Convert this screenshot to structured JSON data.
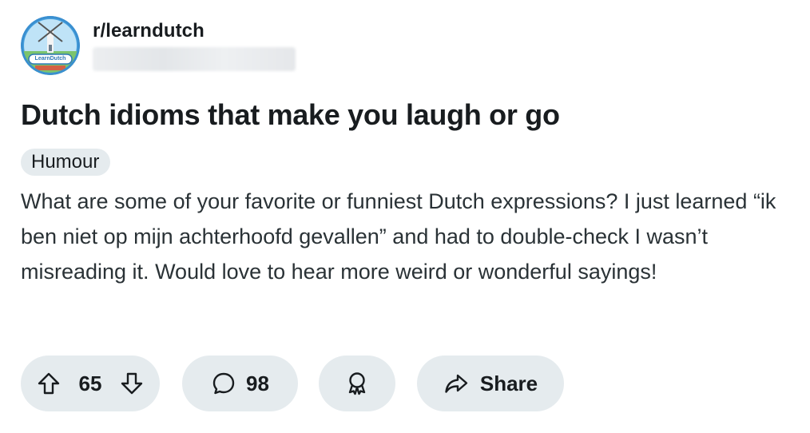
{
  "post": {
    "subreddit": "r/learndutch",
    "avatar_logo_text": "LearnDutch",
    "title": "Dutch idioms that make you laugh or go",
    "flair": "Humour",
    "body": "What are some of your favorite or funniest Dutch expressions? I just learned “ik ben niet op mijn achterhoofd gevallen” and had to double-check I wasn’t misreading it. Would love to hear more weird or wonderful sayings!"
  },
  "actions": {
    "upvote_icon": "arrow-up-icon",
    "vote_count": "65",
    "downvote_icon": "arrow-down-icon",
    "comment_icon": "speech-bubble-icon",
    "comment_count": "98",
    "award_icon": "award-icon",
    "share_icon": "share-arrow-icon",
    "share_label": "Share"
  },
  "colors": {
    "text": "#181c1f",
    "body_text": "#2a3236",
    "pill_background": "#e5ebee"
  }
}
